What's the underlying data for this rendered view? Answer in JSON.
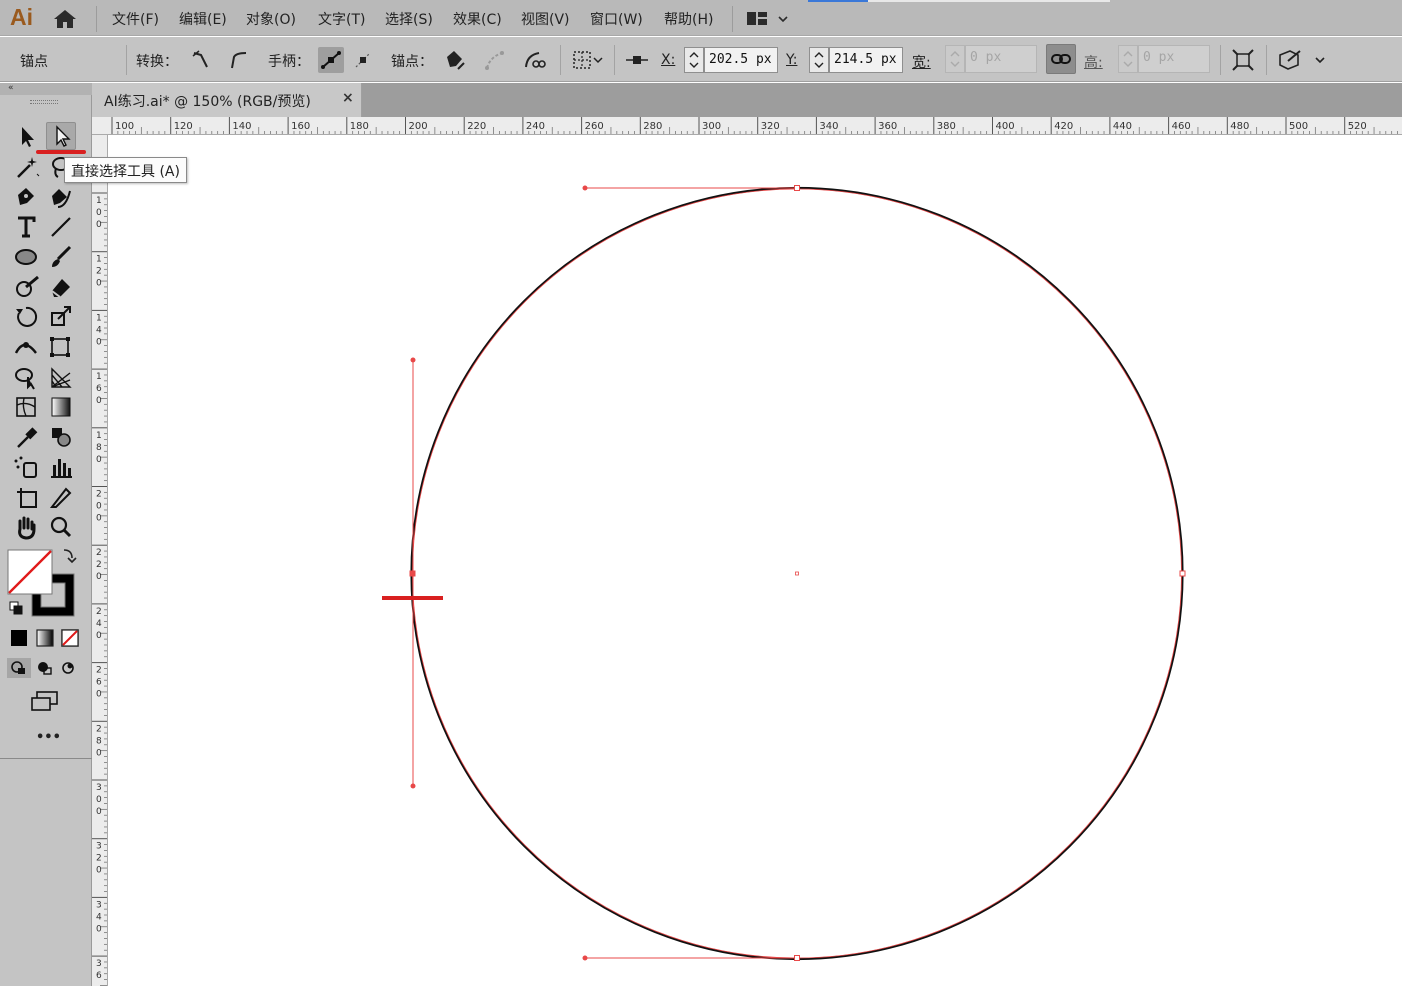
{
  "app": {
    "logo": "Ai"
  },
  "menu": [
    "文件(F)",
    "编辑(E)",
    "对象(O)",
    "文字(T)",
    "选择(S)",
    "效果(C)",
    "视图(V)",
    "窗口(W)",
    "帮助(H)"
  ],
  "control": {
    "section_label": "锚点",
    "convert_label": "转换：",
    "handles_label": "手柄：",
    "anchors_label": "锚点：",
    "x_label": "X:",
    "x_value": "202.5 px",
    "y_label": "Y:",
    "y_value": "214.5 px",
    "w_label": "宽:",
    "w_value": "0 px",
    "h_label": "高:",
    "h_value": "0 px"
  },
  "document": {
    "tab_title": "AI练习.ai* @ 150% (RGB/预览)",
    "close": "×"
  },
  "tooltip": {
    "text": "直接选择工具 (A)"
  },
  "panel": {
    "collapse": "«",
    "more": "•••"
  },
  "ruler": {
    "h_ticks": [
      "100",
      "120",
      "140",
      "160",
      "180",
      "200",
      "220",
      "240",
      "260",
      "280",
      "300",
      "320",
      "340",
      "360",
      "380",
      "400",
      "420",
      "440",
      "460",
      "480",
      "500",
      "520"
    ],
    "v_ticks": [
      [
        "1",
        "0",
        "0"
      ],
      [
        "1",
        "2",
        "0"
      ],
      [
        "1",
        "4",
        "0"
      ],
      [
        "1",
        "6",
        "0"
      ],
      [
        "1",
        "8",
        "0"
      ],
      [
        "2",
        "0",
        "0"
      ],
      [
        "2",
        "2",
        "0"
      ],
      [
        "2",
        "4",
        "0"
      ],
      [
        "2",
        "6",
        "0"
      ],
      [
        "2",
        "8",
        "0"
      ],
      [
        "3",
        "0",
        "0"
      ],
      [
        "3",
        "2",
        "0"
      ],
      [
        "3",
        "4",
        "0"
      ],
      [
        "3",
        "6"
      ]
    ]
  },
  "colors": {
    "annotation": "#d92020",
    "path_selection": "#e84848",
    "accent": "#3a78d8"
  },
  "icons": {
    "tools": [
      "selection-tool",
      "direct-selection-tool",
      "magic-wand-tool",
      "lasso-tool",
      "pen-tool",
      "curvature-tool",
      "type-tool",
      "line-segment-tool",
      "ellipse-tool",
      "paintbrush-tool",
      "shaper-tool",
      "eraser-tool",
      "rotate-tool",
      "scale-tool",
      "width-tool",
      "free-transform-tool",
      "shape-builder-tool",
      "perspective-grid-tool",
      "mesh-tool",
      "gradient-tool",
      "eyedropper-tool",
      "blend-tool",
      "symbol-sprayer-tool",
      "column-graph-tool",
      "artboard-tool",
      "slice-tool",
      "hand-tool",
      "zoom-tool"
    ]
  }
}
